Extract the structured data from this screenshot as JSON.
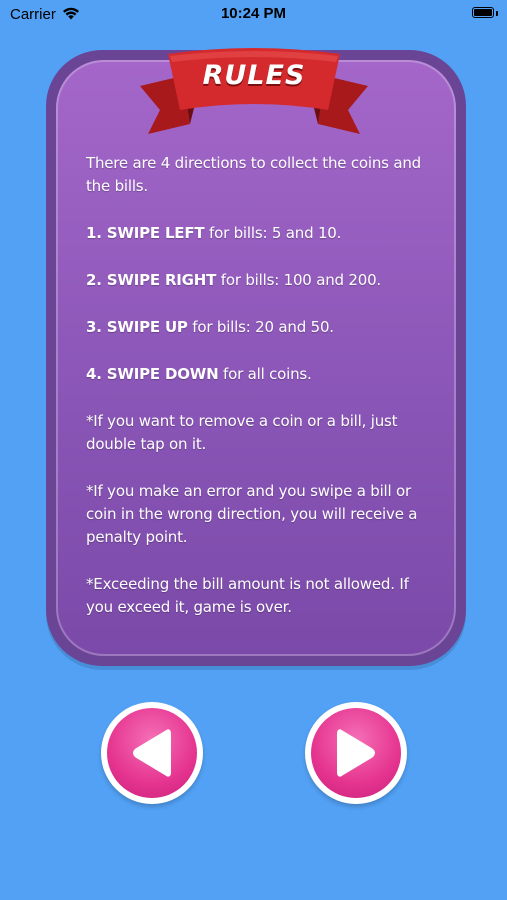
{
  "status_bar": {
    "carrier": "Carrier",
    "time": "10:24 PM",
    "icons": [
      "wifi-icon",
      "battery-icon"
    ]
  },
  "banner": {
    "title": "RULES",
    "color": "#d42a2d"
  },
  "rules": {
    "intro": "There are 4 directions to collect the coins and the bills.",
    "rule1_action": "1. SWIPE LEFT",
    "rule1_text": " for bills: 5 and 10.",
    "rule2_action": "2. SWIPE RIGHT",
    "rule2_text": " for bills: 100 and 200.",
    "rule3_action": "3. SWIPE UP",
    "rule3_text": " for bills: 20 and 50.",
    "rule4_action": "4. SWIPE DOWN",
    "rule4_text": " for all coins.",
    "note1": "*If you want to remove a coin or a bill, just double tap on it.",
    "note2": "*If you make an error and you swipe a bill or coin in the wrong direction, you will receive a penalty point.",
    "note3": "*Exceeding the bill amount is not allowed. If you exceed it, game is over."
  },
  "navigation": {
    "prev_icon": "arrow-left-icon",
    "next_icon": "arrow-right-icon",
    "accent": "#e5348f"
  },
  "colors": {
    "background": "#52a1f5",
    "panel_border": "#6a4596",
    "panel_fill": "#9560c0"
  }
}
